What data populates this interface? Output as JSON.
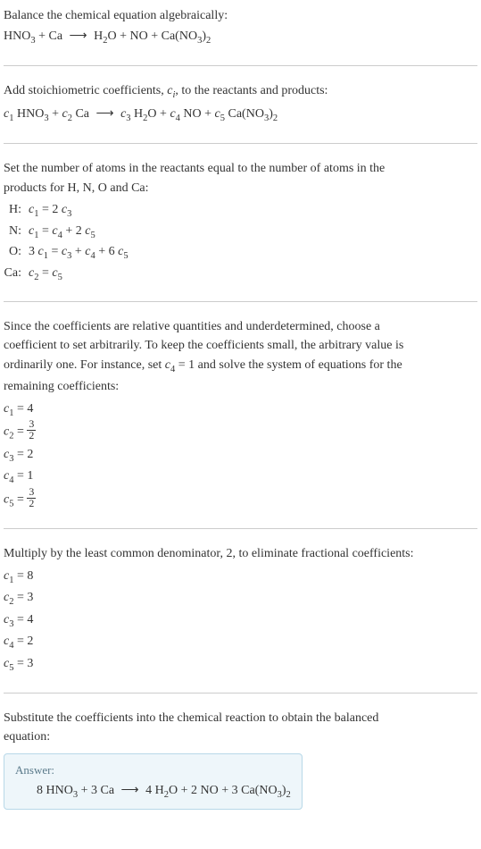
{
  "section1": {
    "line1": "Balance the chemical equation algebraically:",
    "equation": "HNO₃ + Ca ⟶ H₂O + NO + Ca(NO₃)₂"
  },
  "section2": {
    "line1_prefix": "Add stoichiometric coefficients, ",
    "line1_var": "cᵢ",
    "line1_suffix": ", to the reactants and products:",
    "equation": "c₁ HNO₃ + c₂ Ca ⟶ c₃ H₂O + c₄ NO + c₅ Ca(NO₃)₂"
  },
  "section3": {
    "intro1": "Set the number of atoms in the reactants equal to the number of atoms in the",
    "intro2": "products for H, N, O and Ca:",
    "atoms": [
      {
        "label": "H:",
        "eq": "c₁ = 2 c₃"
      },
      {
        "label": "N:",
        "eq": "c₁ = c₄ + 2 c₅"
      },
      {
        "label": "O:",
        "eq": "3 c₁ = c₃ + c₄ + 6 c₅"
      },
      {
        "label": "Ca:",
        "eq": "c₂ = c₅"
      }
    ]
  },
  "section4": {
    "intro1": "Since the coefficients are relative quantities and underdetermined, choose a",
    "intro2": "coefficient to set arbitrarily. To keep the coefficients small, the arbitrary value is",
    "intro3": "ordinarily one. For instance, set c₄ = 1 and solve the system of equations for the",
    "intro4": "remaining coefficients:",
    "coefs": [
      {
        "var": "c₁",
        "val": "4",
        "frac": false
      },
      {
        "var": "c₂",
        "num": "3",
        "den": "2",
        "frac": true
      },
      {
        "var": "c₃",
        "val": "2",
        "frac": false
      },
      {
        "var": "c₄",
        "val": "1",
        "frac": false
      },
      {
        "var": "c₅",
        "num": "3",
        "den": "2",
        "frac": true
      }
    ]
  },
  "section5": {
    "intro": "Multiply by the least common denominator, 2, to eliminate fractional coefficients:",
    "coefs": [
      {
        "var": "c₁",
        "val": "8"
      },
      {
        "var": "c₂",
        "val": "3"
      },
      {
        "var": "c₃",
        "val": "4"
      },
      {
        "var": "c₄",
        "val": "2"
      },
      {
        "var": "c₅",
        "val": "3"
      }
    ]
  },
  "section6": {
    "intro1": "Substitute the coefficients into the chemical reaction to obtain the balanced",
    "intro2": "equation:",
    "answer_label": "Answer:",
    "answer_eq": "8 HNO₃ + 3 Ca ⟶ 4 H₂O + 2 NO + 3 Ca(NO₃)₂"
  },
  "chart_data": {
    "type": "table",
    "title": "Chemical equation balancing",
    "reactants": [
      "HNO₃",
      "Ca"
    ],
    "products": [
      "H₂O",
      "NO",
      "Ca(NO₃)₂"
    ],
    "element_balance": {
      "H": "c₁ = 2 c₃",
      "N": "c₁ = c₄ + 2 c₅",
      "O": "3 c₁ = c₃ + c₄ + 6 c₅",
      "Ca": "c₂ = c₅"
    },
    "initial_solution": {
      "c1": 4,
      "c2": 1.5,
      "c3": 2,
      "c4": 1,
      "c5": 1.5
    },
    "lcm": 2,
    "final_solution": {
      "c1": 8,
      "c2": 3,
      "c3": 4,
      "c4": 2,
      "c5": 3
    },
    "balanced_equation": "8 HNO₃ + 3 Ca ⟶ 4 H₂O + 2 NO + 3 Ca(NO₃)₂"
  }
}
